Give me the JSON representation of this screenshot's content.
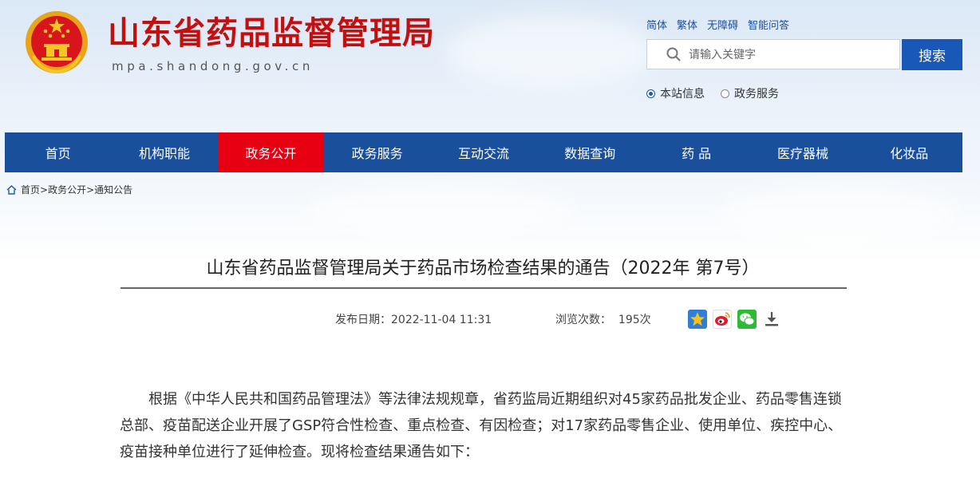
{
  "header": {
    "site_title": "山东省药品监督管理局",
    "site_domain": "mpa.shandong.gov.cn",
    "top_links": [
      "简体",
      "繁体",
      "无障碍",
      "智能问答"
    ]
  },
  "search": {
    "placeholder": "请输入关键字",
    "button_label": "搜索",
    "scope_options": [
      "本站信息",
      "政务服务"
    ],
    "selected_scope": "本站信息"
  },
  "nav": {
    "items": [
      "首页",
      "机构职能",
      "政务公开",
      "政务服务",
      "互动交流",
      "数据查询",
      "药 品",
      "医疗器械",
      "化妆品"
    ],
    "active": "政务公开"
  },
  "breadcrumb": {
    "items": [
      "首页",
      "政务公开",
      "通知公告"
    ],
    "separator": ">"
  },
  "article": {
    "title": "山东省药品监督管理局关于药品市场检查结果的通告（2022年 第7号）",
    "publish_label": "发布日期：",
    "publish_date": "2022-11-04 11:31",
    "views_label": "浏览次数：",
    "views_value": "195次",
    "body": "根据《中华人民共和国药品管理法》等法律法规规章，省药监局近期组织对45家药品批发企业、药品零售连锁总部、疫苗配送企业开展了GSP符合性检查、重点检查、有因检查；对17家药品零售企业、使用单位、疾控中心、疫苗接种单位进行了延伸检查。现将检查结果通告如下："
  },
  "share_icons": [
    "qzone-star-icon",
    "weibo-icon",
    "wechat-icon",
    "download-icon"
  ],
  "colors": {
    "title_red": "#c40f0f",
    "nav_blue": "#1a4f9c",
    "nav_active_red": "#e60012",
    "search_blue": "#1a58b8"
  }
}
